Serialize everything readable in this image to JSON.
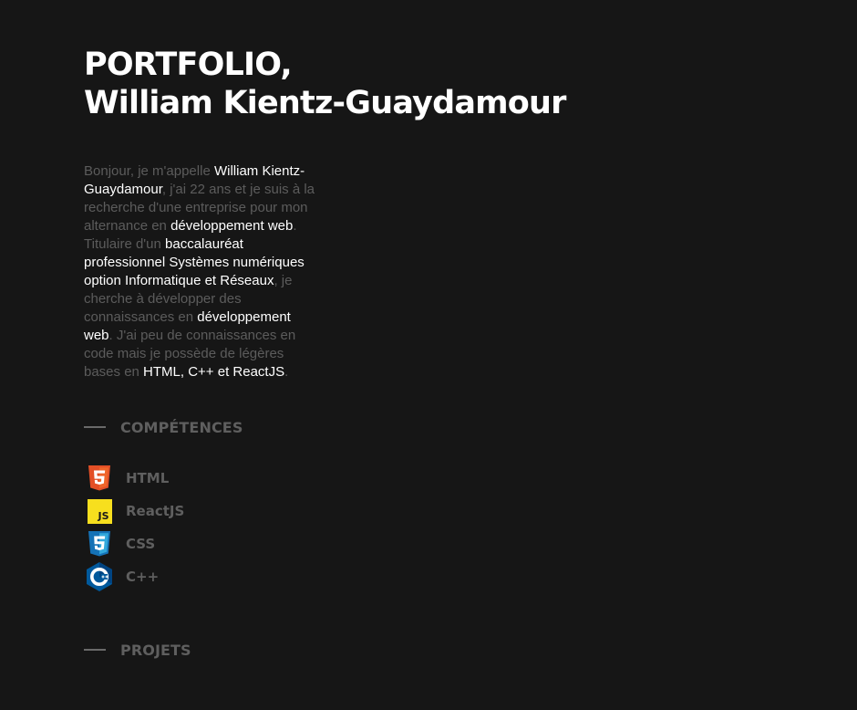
{
  "header": {
    "title_line1": "PORTFOLIO,",
    "title_line2": "William Kientz-Guaydamour"
  },
  "intro": {
    "t1": "Bonjour, je m'appelle ",
    "h1": "William Kientz-Guaydamour",
    "t2": ", j'ai 22 ans et je suis à la recherche d'une entreprise pour mon alternance en ",
    "h2": "développement web",
    "t3": ". Titulaire d'un ",
    "h3": "baccalauréat professionnel Systèmes numériques option Informatique et Réseaux",
    "t4": ", je cherche à développer des connaissances en ",
    "h4": "développement web",
    "t5": ". J'ai peu de connaissances en code mais je possède de légères bases en ",
    "h5": "HTML, C++ et ReactJS",
    "t6": "."
  },
  "skills_section": {
    "title": "COMPÉTENCES",
    "items": [
      {
        "label": "HTML",
        "icon": "html5-icon",
        "color": "#e34f26"
      },
      {
        "label": "ReactJS",
        "icon": "js-icon",
        "color": "#f7df1e"
      },
      {
        "label": "CSS",
        "icon": "css3-icon",
        "color": "#1572b6"
      },
      {
        "label": "C++",
        "icon": "cpp-icon",
        "color": "#00599c"
      }
    ]
  },
  "projects_section": {
    "title": "PROJETS"
  }
}
